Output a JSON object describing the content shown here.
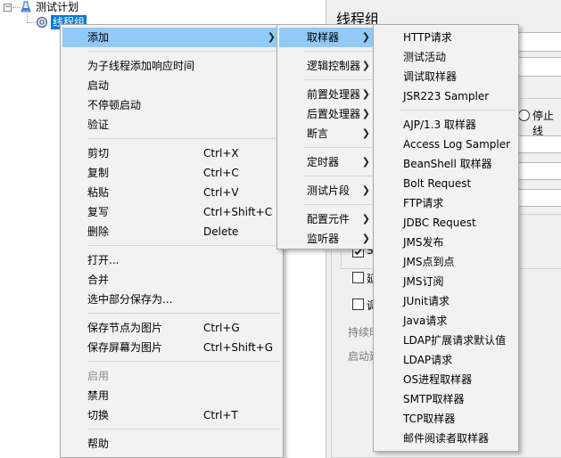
{
  "tree": {
    "test_plan_label": "测试计划",
    "thread_group_label": "线程组",
    "collapse_symbol": "−"
  },
  "right_panel": {
    "title": "线程组",
    "radio_label": "停止线",
    "check1_label": "S",
    "check2_label": "延",
    "check3_label": "调",
    "text1": "持续时",
    "text2": "启动延"
  },
  "context_menu": {
    "items": [
      {
        "label": "添加",
        "shortcut": "",
        "submenu": true,
        "highlighted": true
      },
      {
        "label": "为子线程添加响应时间",
        "shortcut": ""
      },
      {
        "label": "启动",
        "shortcut": ""
      },
      {
        "label": "不停顿启动",
        "shortcut": ""
      },
      {
        "label": "验证",
        "shortcut": ""
      },
      {
        "label": "剪切",
        "shortcut": "Ctrl+X"
      },
      {
        "label": "复制",
        "shortcut": "Ctrl+C"
      },
      {
        "label": "粘贴",
        "shortcut": "Ctrl+V"
      },
      {
        "label": "复写",
        "shortcut": "Ctrl+Shift+C"
      },
      {
        "label": "删除",
        "shortcut": "Delete"
      },
      {
        "label": "打开...",
        "shortcut": ""
      },
      {
        "label": "合并",
        "shortcut": ""
      },
      {
        "label": "选中部分保存为...",
        "shortcut": ""
      },
      {
        "label": "保存节点为图片",
        "shortcut": "Ctrl+G"
      },
      {
        "label": "保存屏幕为图片",
        "shortcut": "Ctrl+Shift+G"
      },
      {
        "label": "启用",
        "shortcut": "",
        "disabled": true
      },
      {
        "label": "禁用",
        "shortcut": ""
      },
      {
        "label": "切换",
        "shortcut": "Ctrl+T"
      },
      {
        "label": "帮助",
        "shortcut": ""
      }
    ]
  },
  "add_submenu": {
    "items": [
      {
        "label": "取样器",
        "highlighted": true
      },
      {
        "label": "逻辑控制器"
      },
      {
        "label": "前置处理器"
      },
      {
        "label": "后置处理器"
      },
      {
        "label": "断言"
      },
      {
        "label": "定时器"
      },
      {
        "label": "测试片段"
      },
      {
        "label": "配置元件"
      },
      {
        "label": "监听器"
      }
    ]
  },
  "sampler_submenu": {
    "items": [
      "HTTP请求",
      "测试活动",
      "调试取样器",
      "JSR223 Sampler",
      "AJP/1.3 取样器",
      "Access Log Sampler",
      "BeanShell 取样器",
      "Bolt Request",
      "FTP请求",
      "JDBC Request",
      "JMS发布",
      "JMS点到点",
      "JMS订阅",
      "JUnit请求",
      "Java请求",
      "LDAP扩展请求默认值",
      "LDAP请求",
      "OS进程取样器",
      "SMTP取样器",
      "TCP取样器",
      "邮件阅读者取样器"
    ]
  },
  "colors": {
    "highlight": "#91c9f7",
    "selection": "#0078d7",
    "menu_background": "#f2f2f2"
  }
}
